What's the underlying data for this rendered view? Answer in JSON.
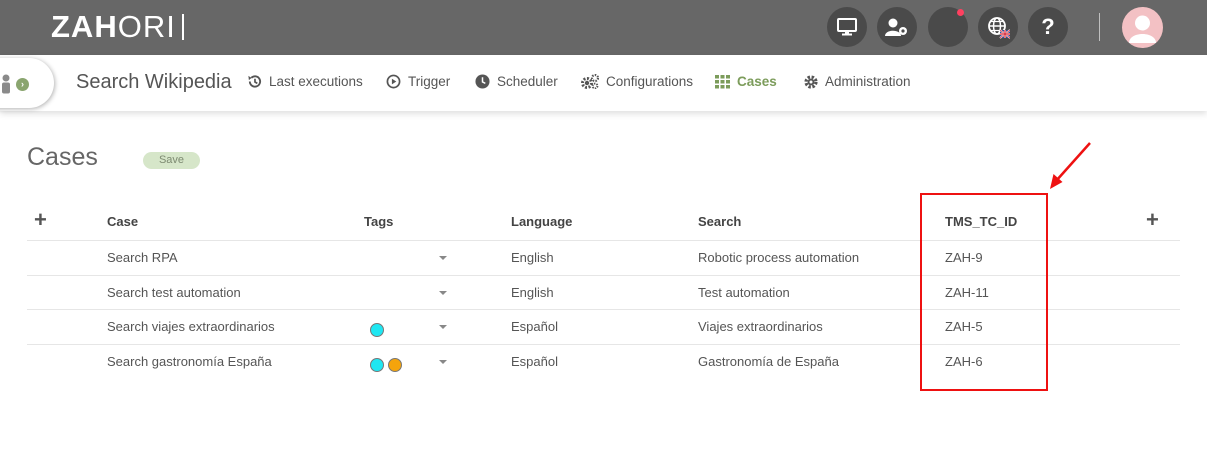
{
  "app": {
    "logo": "ZAHORI",
    "logo_bold": "ZAH",
    "logo_thin": "ORI"
  },
  "topbar": {
    "buttons": [
      {
        "icon": "monitor-icon"
      },
      {
        "icon": "user-gear-icon"
      },
      {
        "icon": "notification-icon"
      },
      {
        "icon": "globe-language-icon",
        "flag": "uk-flag-icon"
      },
      {
        "icon": "help-icon",
        "label": "?"
      }
    ],
    "avatar": "user-avatar-icon"
  },
  "subnav": {
    "project_title": "Search Wikipedia",
    "items": [
      {
        "label": "Last executions",
        "icon": "history-icon"
      },
      {
        "label": "Trigger",
        "icon": "play-circle-icon"
      },
      {
        "label": "Scheduler",
        "icon": "clock-icon"
      },
      {
        "label": "Configurations",
        "icon": "cogs-icon"
      },
      {
        "label": "Cases",
        "icon": "grid-icon",
        "active": true
      },
      {
        "label": "Administration",
        "icon": "gear-icon"
      }
    ]
  },
  "page": {
    "title": "Cases",
    "save_label": "Save"
  },
  "table": {
    "headers": {
      "case": "Case",
      "tags": "Tags",
      "language": "Language",
      "search": "Search",
      "tms": "TMS_TC_ID"
    },
    "add_symbol": "+",
    "rows": [
      {
        "case": "Search RPA",
        "tags": [],
        "language": "English",
        "search": "Robotic process automation",
        "tms": "ZAH-9"
      },
      {
        "case": "Search test automation",
        "tags": [],
        "language": "English",
        "search": "Test automation",
        "tms": "ZAH-11"
      },
      {
        "case": "Search viajes extraordinarios",
        "tags": [
          "#1fe7f2"
        ],
        "language": "Español",
        "search": "Viajes extraordinarios",
        "tms": "ZAH-5"
      },
      {
        "case": "Search gastronomía España",
        "tags": [
          "#1fe7f2",
          "#f5a40c"
        ],
        "language": "Español",
        "search": "Gastronomía de España",
        "tms": "ZAH-6"
      }
    ]
  },
  "colors": {
    "topbar": "#676767",
    "accent": "#7c9c5b",
    "annotation": "#ee1111"
  }
}
